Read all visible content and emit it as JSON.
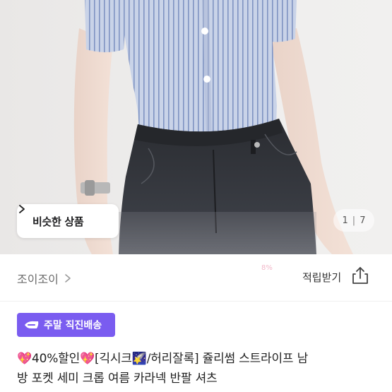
{
  "product_image": {
    "similar_button_label": "비슷한 상품",
    "pager": {
      "current": "1",
      "separator": "|",
      "total": "7"
    }
  },
  "shop": {
    "name": "조이조이",
    "points_faint": "8%",
    "points_button_label": "적립받기"
  },
  "badge": {
    "label": "주말 직진배송"
  },
  "title": {
    "line1": "💖40%할인💖[긱시크🌠/허리잘록] 쥴리썸 스트라이프 남",
    "line2": "방 포켓 세미 크롭 여름 카라넥 반팔 셔츠"
  },
  "colors": {
    "badge_bg": "#7a5cf0",
    "shirt_stripe": "#8fa3cc",
    "jeans": "#2b2d31"
  },
  "icons": [
    "chevron-right-icon",
    "share-icon",
    "truck-icon"
  ]
}
